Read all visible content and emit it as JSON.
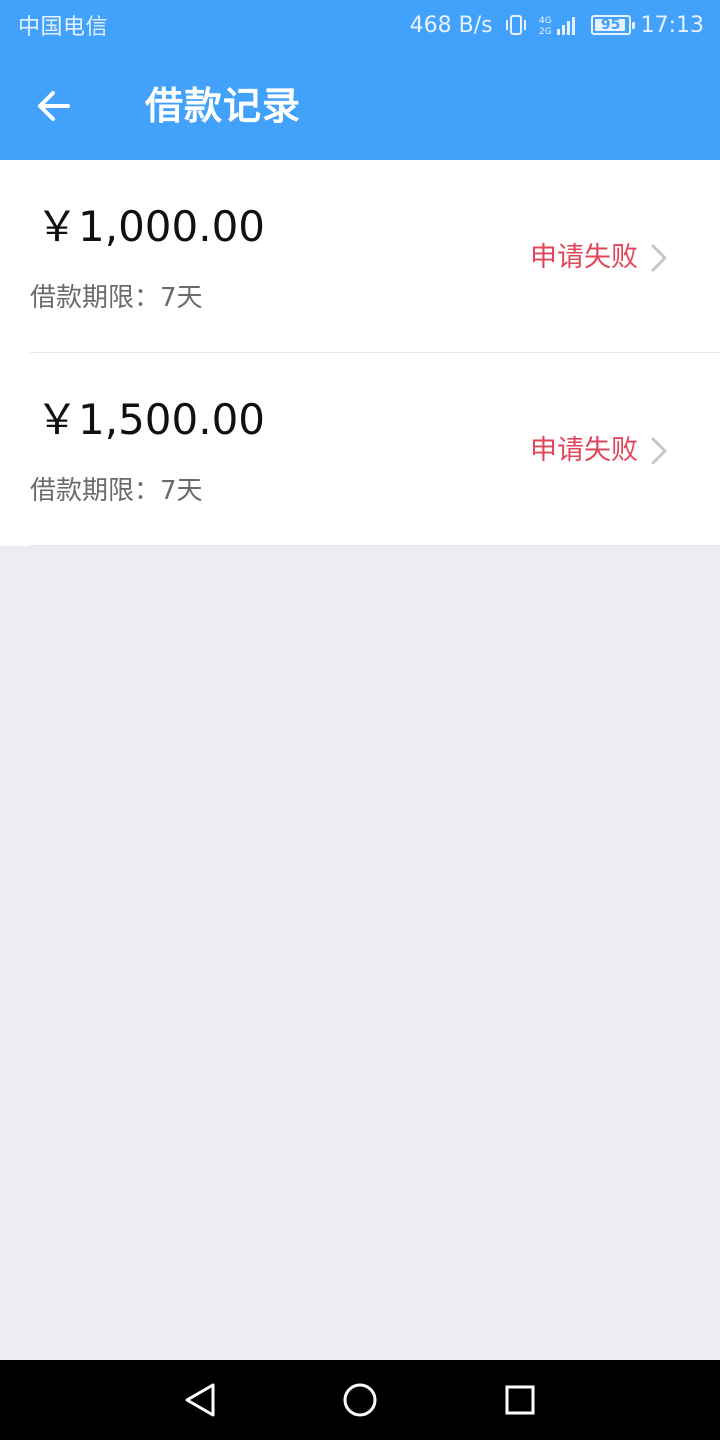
{
  "status_bar": {
    "carrier": "中国电信",
    "net_speed": "468 B/s",
    "battery_level": "95",
    "battery_fraction": 0.95,
    "time": "17:13",
    "icons": [
      "vibrate-icon",
      "signal-4g-icon",
      "battery-icon"
    ]
  },
  "header": {
    "title": "借款记录",
    "back_icon": "arrow-left-icon",
    "background_color": "#42a2fb"
  },
  "records": [
    {
      "amount": "￥1,000.00",
      "term": "借款期限：7天",
      "status": "申请失败"
    },
    {
      "amount": "￥1,500.00",
      "term": "借款期限：7天",
      "status": "申请失败"
    }
  ],
  "colors": {
    "status_failed": "#e0475a",
    "page_background": "#ececf2"
  },
  "nav_bar": {
    "icons": [
      "back-triangle-icon",
      "home-circle-icon",
      "recents-square-icon"
    ]
  }
}
